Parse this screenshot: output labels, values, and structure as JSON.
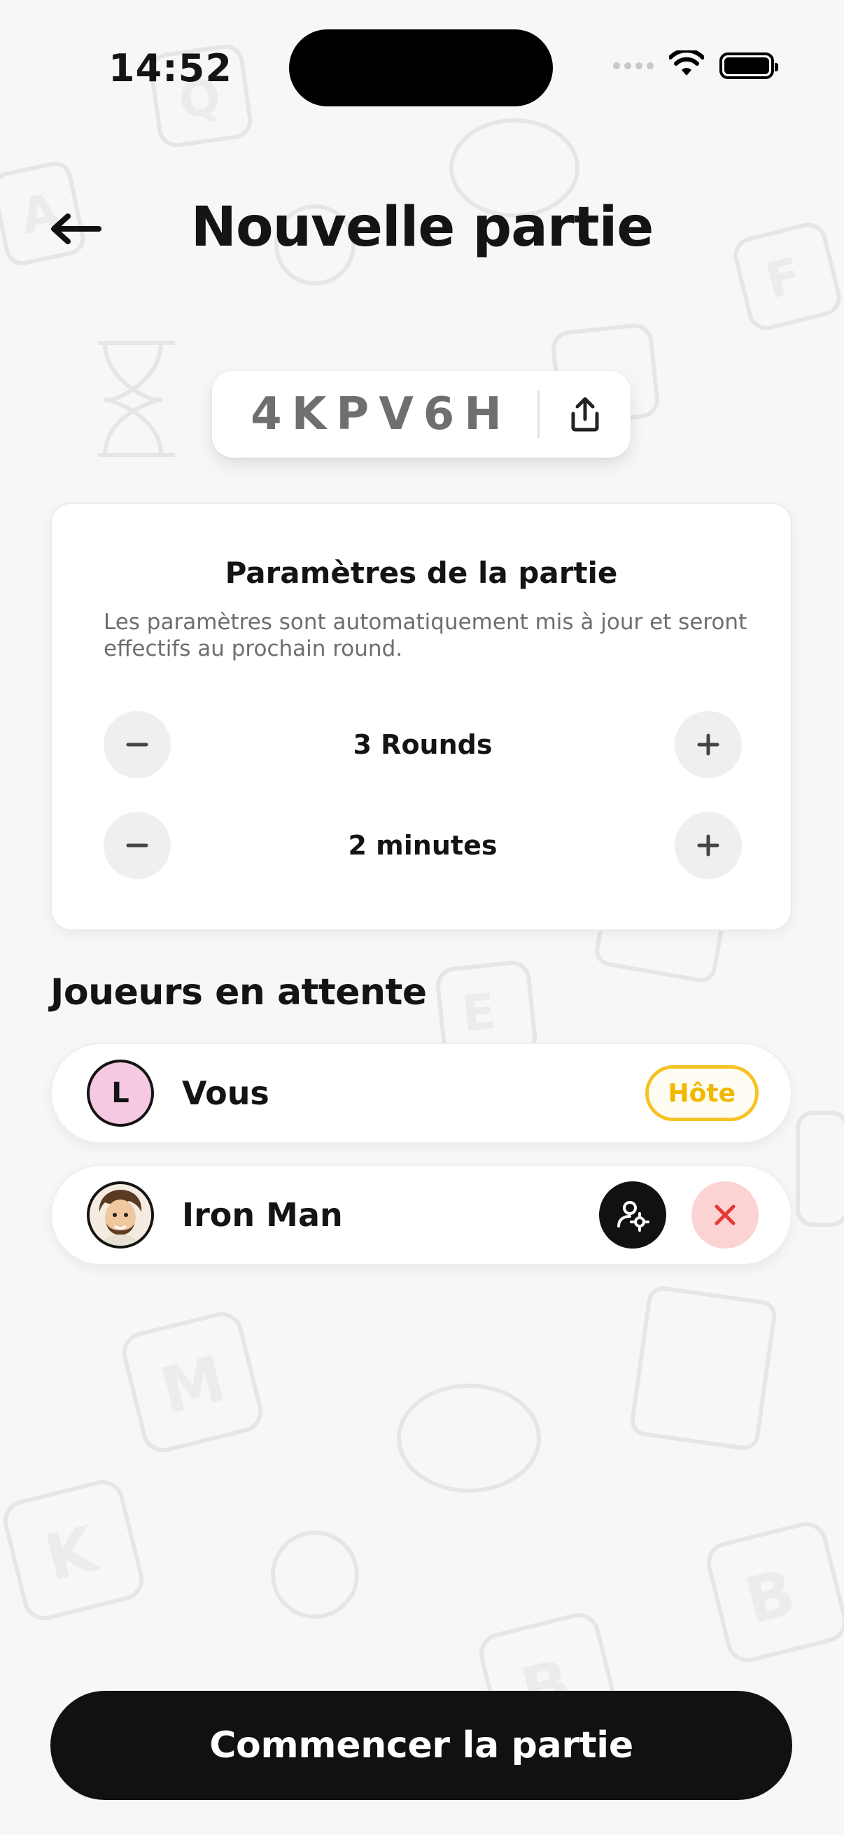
{
  "status_bar": {
    "time": "14:52",
    "wifi_icon": "wifi-icon",
    "battery_icon": "battery-full-icon"
  },
  "header": {
    "back_icon": "arrow-left-icon",
    "title": "Nouvelle partie"
  },
  "game_code": {
    "code": "4KPV6H",
    "share_icon": "share-icon"
  },
  "settings": {
    "title": "Paramètres de la partie",
    "description": "Les paramètres sont automatiquement mis à jour et seront effectifs au prochain round.",
    "rounds_label": "3 Rounds",
    "duration_label": "2 minutes",
    "decrement_icon": "minus-icon",
    "increment_icon": "plus-icon"
  },
  "players": {
    "title": "Joueurs en attente",
    "list": [
      {
        "initial": "L",
        "name": "Vous",
        "badge": "Hôte"
      },
      {
        "name": "Iron Man",
        "avatar_icon": "cartoon-avatar-icon",
        "promote_icon": "user-gear-icon",
        "kick_icon": "close-icon"
      }
    ]
  },
  "start_button": {
    "label": "Commencer la partie"
  },
  "colors": {
    "background": "#f7f7f7",
    "primary": "#111111",
    "host_badge": "#f6c224",
    "kick_bg": "#fbd3d3",
    "kick_icon": "#e53935",
    "avatar_pink": "#f6c9e2"
  }
}
